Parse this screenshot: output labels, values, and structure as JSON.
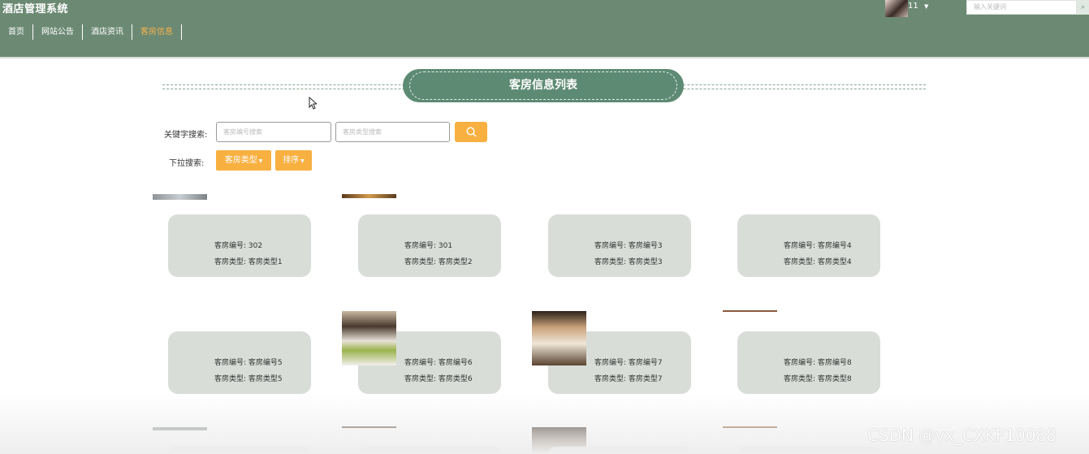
{
  "header": {
    "app_title": "酒店管理系统",
    "nav": [
      {
        "label": "首页",
        "active": false
      },
      {
        "label": "网站公告",
        "active": false
      },
      {
        "label": "酒店资讯",
        "active": false
      },
      {
        "label": "客房信息",
        "active": true
      }
    ],
    "username": "11",
    "search_placeholder": "输入关键词"
  },
  "section_title": "客房信息列表",
  "search": {
    "keyword_label": "关键字搜索:",
    "room_no_placeholder": "客房编号搜索",
    "room_type_placeholder": "客房类型搜索",
    "dropdown_label": "下拉搜索:",
    "room_type_dropdown": "客房类型",
    "sort_dropdown": "排序"
  },
  "rooms": [
    {
      "no_label": "客房编号:",
      "no": "302",
      "type_label": "客房类型:",
      "type": "客房类型1"
    },
    {
      "no_label": "客房编号:",
      "no": "301",
      "type_label": "客房类型:",
      "type": "客房类型2"
    },
    {
      "no_label": "客房编号:",
      "no": "客房编号3",
      "type_label": "客房类型:",
      "type": "客房类型3"
    },
    {
      "no_label": "客房编号:",
      "no": "客房编号4",
      "type_label": "客房类型:",
      "type": "客房类型4"
    },
    {
      "no_label": "客房编号:",
      "no": "客房编号5",
      "type_label": "客房类型:",
      "type": "客房类型5"
    },
    {
      "no_label": "客房编号:",
      "no": "客房编号6",
      "type_label": "客房类型:",
      "type": "客房类型6"
    },
    {
      "no_label": "客房编号:",
      "no": "客房编号7",
      "type_label": "客房类型:",
      "type": "客房类型7"
    },
    {
      "no_label": "客房编号:",
      "no": "客房编号8",
      "type_label": "客房类型:",
      "type": "客房类型8"
    }
  ],
  "watermark": "CSDN @vx_CXKF10088",
  "colors": {
    "header_bg": "#6c8a73",
    "accent_orange": "#f8b040",
    "card_bg": "#d8ddd8",
    "title_pill": "#5d8a73"
  }
}
